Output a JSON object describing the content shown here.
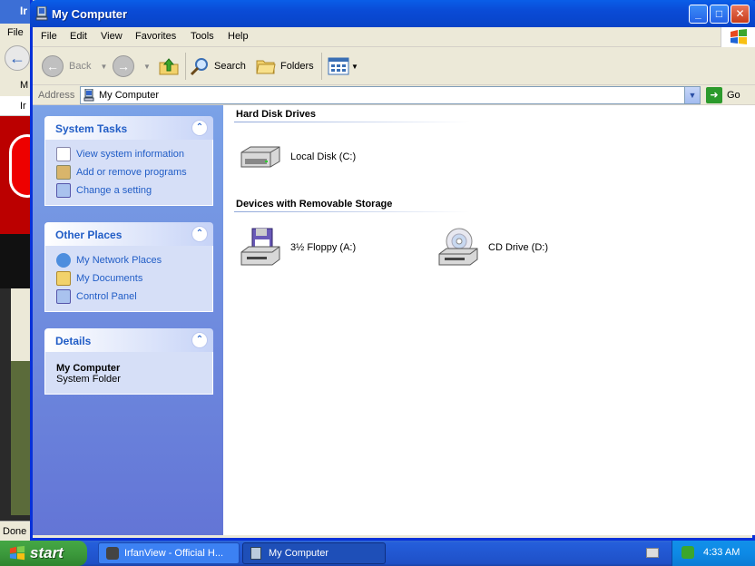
{
  "background_app": {
    "title": "Ir",
    "menu": "File",
    "address_frag": "M",
    "tab_frag": "Ir",
    "status": "Done"
  },
  "window": {
    "title": "My Computer",
    "controls": {
      "minimize": "_",
      "maximize": "□",
      "close": "✕"
    }
  },
  "menu": [
    "File",
    "Edit",
    "View",
    "Favorites",
    "Tools",
    "Help"
  ],
  "toolbar": {
    "back": "Back",
    "search": "Search",
    "folders": "Folders"
  },
  "address": {
    "label": "Address",
    "value": "My Computer",
    "go": "Go"
  },
  "taskpane": {
    "system_tasks": {
      "title": "System Tasks",
      "items": [
        "View system information",
        "Add or remove programs",
        "Change a setting"
      ]
    },
    "other_places": {
      "title": "Other Places",
      "items": [
        "My Network Places",
        "My Documents",
        "Control Panel"
      ]
    },
    "details": {
      "title": "Details",
      "name": "My Computer",
      "type": "System Folder"
    }
  },
  "content": {
    "hard_disk": {
      "heading": "Hard Disk Drives",
      "drives": [
        "Local Disk (C:)"
      ]
    },
    "removable": {
      "heading": "Devices with Removable Storage",
      "drives": [
        "3½ Floppy (A:)",
        "CD Drive (D:)"
      ]
    }
  },
  "taskbar": {
    "start": "start",
    "tasks": [
      "IrfanView - Official H...",
      "My Computer"
    ],
    "clock": "4:33 AM"
  },
  "colors": {
    "title_blue": "#0a4bd6",
    "taskpane_blue": "#6375d6",
    "link_blue": "#215dc6",
    "start_green": "#3c9a3c"
  }
}
